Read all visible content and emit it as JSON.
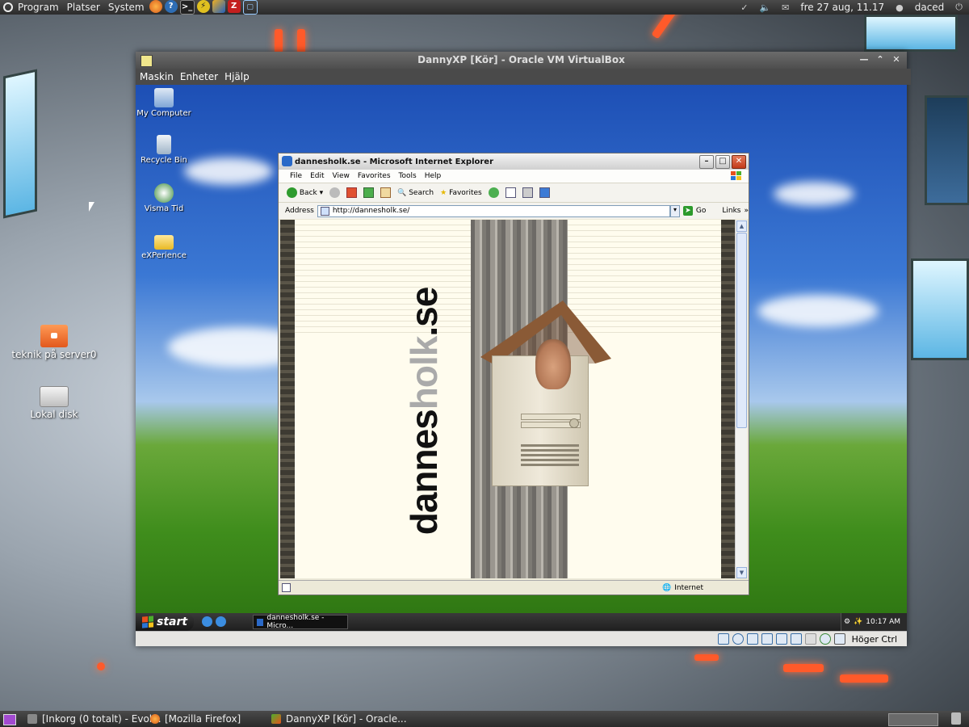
{
  "top_panel": {
    "menus": [
      "Program",
      "Platser",
      "System"
    ],
    "clock": "fre 27 aug, 11.17",
    "user": "daced"
  },
  "host_desktop": {
    "icons": [
      {
        "label": "teknik på server0"
      },
      {
        "label": "Lokal disk"
      }
    ]
  },
  "bottom_panel": {
    "tasks": [
      {
        "label": "[Inkorg (0 totalt) - Evol..."
      },
      {
        "label": "[Mozilla Firefox]"
      },
      {
        "label": "DannyXP [Kör] - Oracle..."
      }
    ]
  },
  "vbox": {
    "title": "DannyXP [Kör] - Oracle VM VirtualBox",
    "menu": [
      "Maskin",
      "Enheter",
      "Hjälp"
    ],
    "host_key": "Höger Ctrl"
  },
  "xp": {
    "desktop_icons": [
      {
        "label": "My Computer"
      },
      {
        "label": "Recycle Bin"
      },
      {
        "label": "Visma Tid"
      },
      {
        "label": "eXPerience"
      }
    ],
    "start_label": "start",
    "task_label": "dannesholk.se - Micro...",
    "clock": "10:17 AM"
  },
  "ie": {
    "title": "dannesholk.se - Microsoft Internet Explorer",
    "menu": [
      "File",
      "Edit",
      "View",
      "Favorites",
      "Tools",
      "Help"
    ],
    "toolbar": {
      "back": "Back",
      "search": "Search",
      "favorites": "Favorites"
    },
    "address_label": "Address",
    "url": "http://dannesholk.se/",
    "go": "Go",
    "links": "Links",
    "status_zone": "Internet",
    "page": {
      "logo_dark_1": "dannes",
      "logo_grey": "holk",
      "logo_dark_2": ".se"
    }
  }
}
